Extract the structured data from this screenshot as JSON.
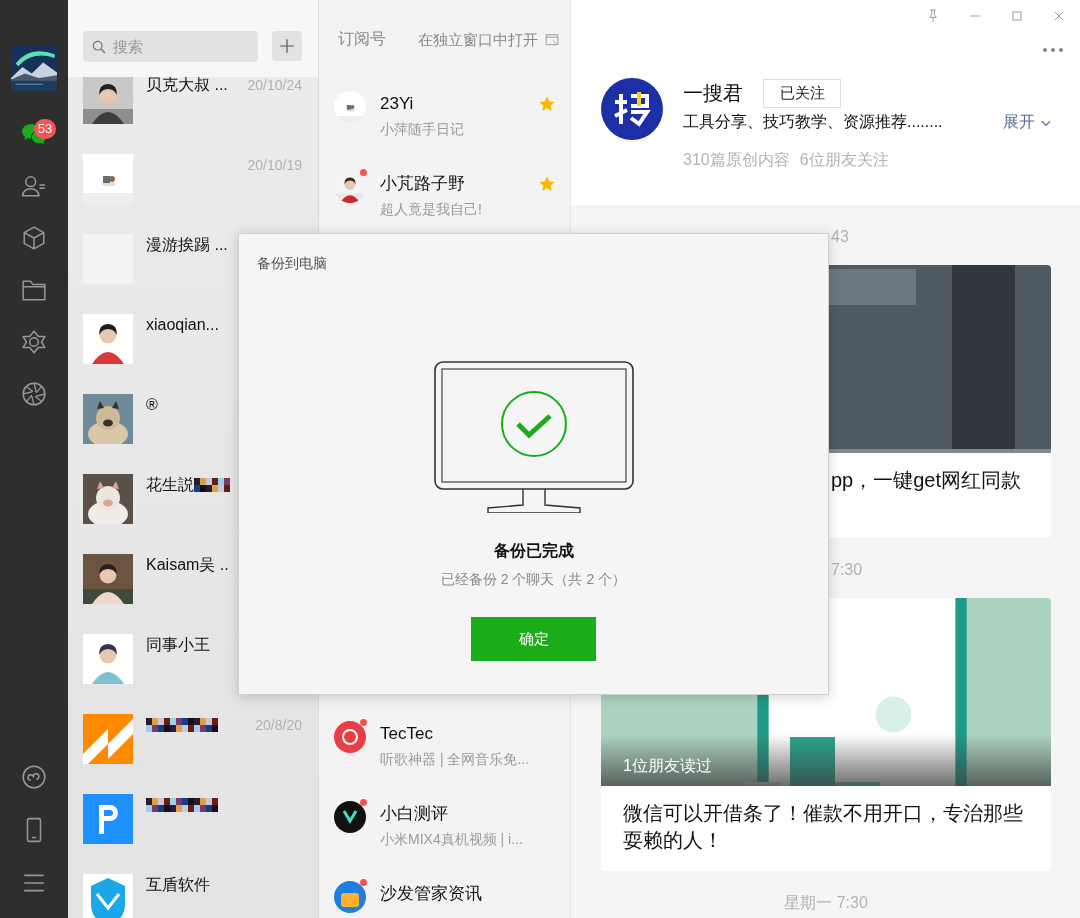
{
  "sidebar": {
    "nav": [
      {
        "kind": "chats",
        "selected": true,
        "badge": "53"
      },
      {
        "kind": "contacts",
        "selected": false
      },
      {
        "kind": "favorites",
        "selected": false
      },
      {
        "kind": "files",
        "selected": false
      },
      {
        "kind": "moments",
        "selected": false
      },
      {
        "kind": "channels",
        "selected": false
      },
      {
        "kind": "miniprograms",
        "selected": false
      },
      {
        "kind": "phone",
        "selected": false
      },
      {
        "kind": "menu",
        "selected": false
      }
    ]
  },
  "chat_list": {
    "search": {
      "placeholder": "搜索"
    },
    "chats": [
      {
        "name": "贝克大叔 ...",
        "date": "20/10/24",
        "kind": "picture"
      },
      {
        "date": "20/10/19",
        "kind": "picture"
      },
      {
        "name": "漫游挨踢 ...",
        "kind": "blank"
      },
      {
        "name": "xiaoqian...",
        "kind": "picture"
      },
      {
        "name": "®",
        "kind": "picture"
      },
      {
        "name": "花生説",
        "mosaic": true,
        "kind": "picture"
      },
      {
        "name": "Kaisam吴 ..",
        "kind": "picture"
      },
      {
        "name": "同事小王",
        "kind": "picture"
      },
      {
        "mosaic": true,
        "date": "20/8/20",
        "kind": "icon"
      },
      {
        "mosaic": true,
        "kind": "icon"
      },
      {
        "name": "互盾软件",
        "kind": "icon"
      }
    ]
  },
  "subscriptions": {
    "title": "订阅号",
    "open_window": "在独立窗口中打开",
    "items": [
      {
        "name": "23Yi",
        "subtitle": "小萍随手日记",
        "kind": "picture",
        "starred": true
      },
      {
        "name": "小芃路子野",
        "subtitle": "超人竟是我自己!",
        "kind": "picture",
        "unread": true,
        "starred": true
      }
    ],
    "more_items": [
      {
        "name": "TecTec",
        "subtitle": "听歌神器 | 全网音乐免...",
        "kind": "icon",
        "unread": true
      },
      {
        "name": "小白测评",
        "subtitle": "小米MIX4真机视频 | i...",
        "kind": "icon",
        "unread": true
      },
      {
        "name": "沙发管家资讯",
        "kind": "icon",
        "unread": true
      }
    ]
  },
  "account": {
    "name": "一搜君",
    "follow_button": "已关注",
    "description": "工具分享、技巧教学、资源推荐........",
    "expand": "展开",
    "stats": [
      "310篇原创内容",
      "6位朋友关注"
    ]
  },
  "feed": [
    {
      "kind": "time",
      "text": "43",
      "clipped": true
    },
    {
      "kind": "article",
      "title": "pp，一键get网红同款",
      "clipped": true
    },
    {
      "kind": "time",
      "text": "7:30",
      "clipped": true
    },
    {
      "kind": "article",
      "title": "微信可以开借条了！催款不用开口，专治那些耍赖的人！",
      "friends_read": "1位朋友读过"
    },
    {
      "kind": "time",
      "text": "星期一 7:30"
    }
  ],
  "dialog": {
    "title": "备份到电脑",
    "heading": "备份已完成",
    "detail": "已经备份 2 个聊天（共 2 个）",
    "button": "确定"
  }
}
